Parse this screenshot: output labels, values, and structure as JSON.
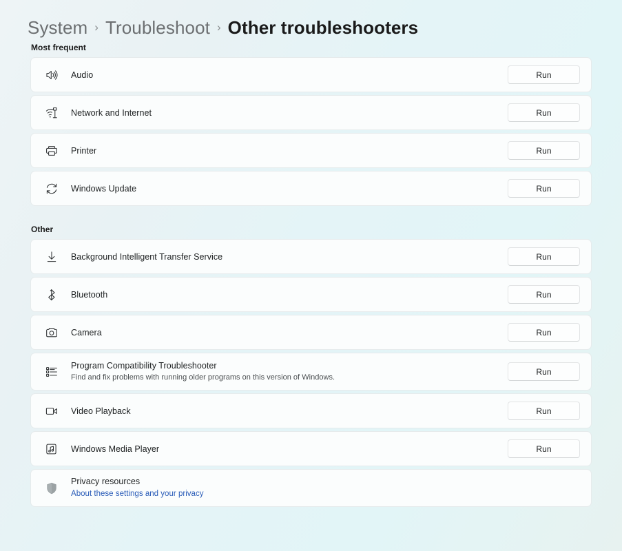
{
  "breadcrumb": {
    "items": [
      {
        "label": "System",
        "current": false
      },
      {
        "label": "Troubleshoot",
        "current": false
      },
      {
        "label": "Other troubleshooters",
        "current": true
      }
    ],
    "separator": "›"
  },
  "sections": [
    {
      "title": "Most frequent",
      "items": [
        {
          "icon": "speaker-icon",
          "label": "Audio",
          "action": "Run"
        },
        {
          "icon": "wifi-network-icon",
          "label": "Network and Internet",
          "action": "Run"
        },
        {
          "icon": "printer-icon",
          "label": "Printer",
          "action": "Run"
        },
        {
          "icon": "sync-refresh-icon",
          "label": "Windows Update",
          "action": "Run"
        }
      ]
    },
    {
      "title": "Other",
      "items": [
        {
          "icon": "download-arrow-icon",
          "label": "Background Intelligent Transfer Service",
          "action": "Run"
        },
        {
          "icon": "bluetooth-icon",
          "label": "Bluetooth",
          "action": "Run"
        },
        {
          "icon": "camera-icon",
          "label": "Camera",
          "action": "Run"
        },
        {
          "icon": "list-detail-icon",
          "label": "Program Compatibility Troubleshooter",
          "sublabel": "Find and fix problems with running older programs on this version of Windows.",
          "action": "Run"
        },
        {
          "icon": "video-camera-icon",
          "label": "Video Playback",
          "action": "Run"
        },
        {
          "icon": "media-player-icon",
          "label": "Windows Media Player",
          "action": "Run"
        }
      ]
    }
  ],
  "privacy": {
    "icon": "shield-icon",
    "label": "Privacy resources",
    "link": "About these settings and your privacy"
  },
  "colors": {
    "accent_link": "#2a5cb8",
    "card_background": "#fbfdfd",
    "text_primary": "#1b1b1b",
    "text_secondary": "#6c6f71"
  }
}
